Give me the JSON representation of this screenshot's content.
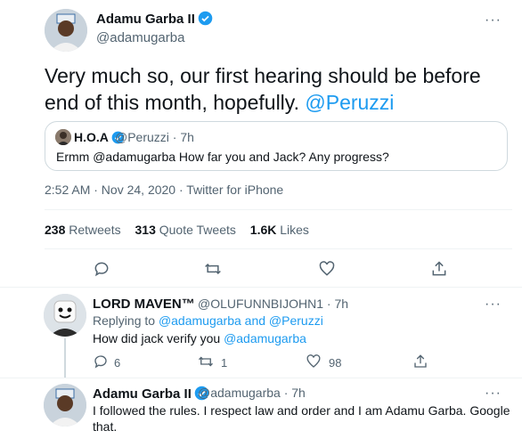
{
  "main_tweet": {
    "name": "Adamu Garba II",
    "handle": "@adamugarba",
    "text_before": "Very much so, our first hearing should be before end of this month, hopefully. ",
    "mention": "@Peruzzi",
    "time": "2:52 AM · Nov 24, 2020 · Twitter for iPhone",
    "more": "···"
  },
  "quoted_tweet": {
    "name": "H.O.A",
    "handle_time": "@Peruzzi · 7h",
    "text_before": "Ermm ",
    "mention": "@adamugarba",
    "text_after": " How far you and Jack? Any progress?"
  },
  "stats": {
    "retweets_count": "238",
    "retweets_label": "Retweets",
    "quotes_count": "313",
    "quotes_label": "Quote Tweets",
    "likes_count": "1.6K",
    "likes_label": "Likes"
  },
  "reply_1": {
    "name": "LORD MAVEN™",
    "handle_time": "@OLUFUNNBIJOHN1 · 7h",
    "replying_prefix": "Replying to ",
    "replying_user1": "@adamugarba",
    "replying_and": " and ",
    "replying_user2": "@Peruzzi",
    "text_before": "How did jack verify you ",
    "mention": "@adamugarba",
    "reply_count": "6",
    "retweet_count": "1",
    "like_count": "98",
    "more": "···"
  },
  "reply_2": {
    "name": "Adamu Garba II",
    "handle_time": "@adamugarba · 7h",
    "text": "I followed the rules. I respect law and order and I am Adamu Garba. Google that.",
    "more": "···"
  },
  "colors": {
    "accent": "#1d9bf0",
    "text": "#0f1419",
    "muted": "#536471",
    "border": "#cfd9de"
  }
}
